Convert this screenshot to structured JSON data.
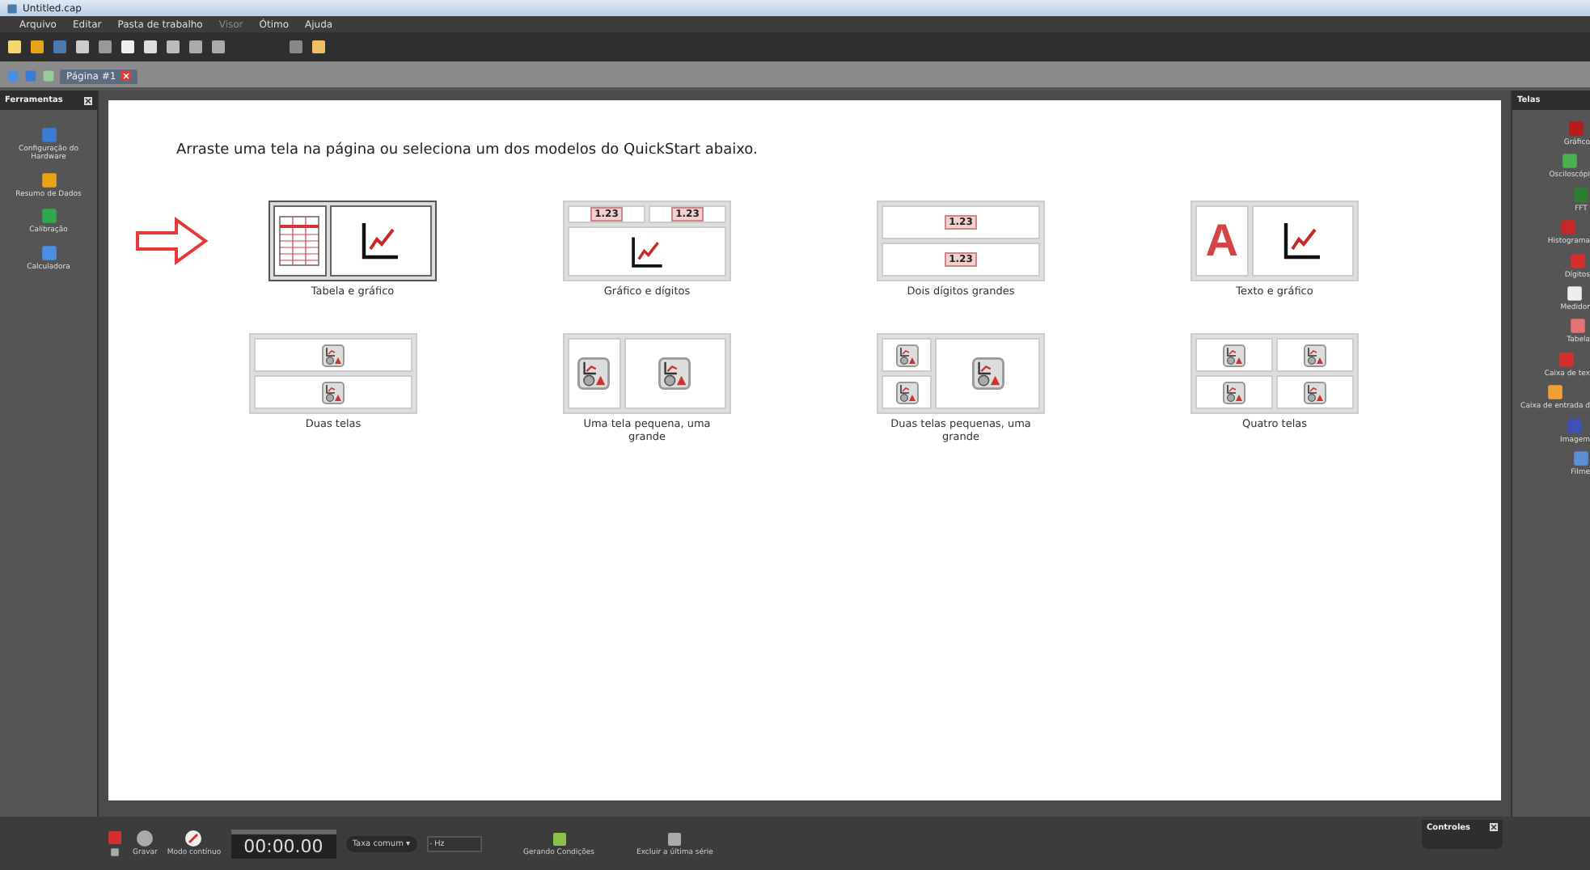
{
  "window": {
    "title": "Untitled.cap"
  },
  "menu": [
    {
      "label": "Arquivo",
      "disabled": false
    },
    {
      "label": "Editar",
      "disabled": false
    },
    {
      "label": "Pasta de trabalho",
      "disabled": false
    },
    {
      "label": "Visor",
      "disabled": true
    },
    {
      "label": "Ótimo",
      "disabled": false
    },
    {
      "label": "Ajuda",
      "disabled": false
    }
  ],
  "page_tabs": [
    {
      "label": "Página #1",
      "selected": true
    }
  ],
  "tools_panel": {
    "title": "Ferramentas",
    "items": [
      "Configuração do Hardware",
      "Resumo de Dados",
      "Calibração",
      "Calculadora"
    ]
  },
  "main": {
    "instruction": "Arraste uma tela na página ou seleciona um dos modelos do QuickStart abaixo.",
    "templates": [
      {
        "kind": "table-graph",
        "label": "Tabela e gráfico",
        "selected": true
      },
      {
        "kind": "graph-digits",
        "label": "Gráfico e dígitos",
        "selected": false,
        "digits": [
          "1.23",
          "1.23"
        ]
      },
      {
        "kind": "two-digits",
        "label": "Dois dígitos grandes",
        "selected": false,
        "digits": [
          "1.23",
          "1.23"
        ]
      },
      {
        "kind": "text-graph",
        "label": "Texto e gráfico",
        "selected": false,
        "letter": "A"
      },
      {
        "kind": "two",
        "label": "Duas telas",
        "selected": false
      },
      {
        "kind": "small-large",
        "label": "Uma tela pequena, uma grande",
        "selected": false
      },
      {
        "kind": "two-small-large",
        "label": "Duas telas pequenas, uma grande",
        "selected": false
      },
      {
        "kind": "four",
        "label": "Quatro telas",
        "selected": false
      }
    ]
  },
  "displays_panel": {
    "title": "Telas",
    "items": [
      "Gráfico",
      "Osciloscópi",
      "FFT",
      "Histograma",
      "Dígitos",
      "Medidor",
      "Tabela",
      "Caixa de tex",
      "Caixa de entrada d",
      "Imagem",
      "Filme"
    ]
  },
  "controls": {
    "record_label": "Gravar",
    "mode_label": "Modo contínuo",
    "timer": "00:00.00",
    "rate": "Taxa comum ▾",
    "rate_value": "- Hz",
    "conditions_label": "Gerando Condições",
    "delete_label": "Excluir a última série"
  },
  "controls_panel": {
    "title": "Controles"
  }
}
